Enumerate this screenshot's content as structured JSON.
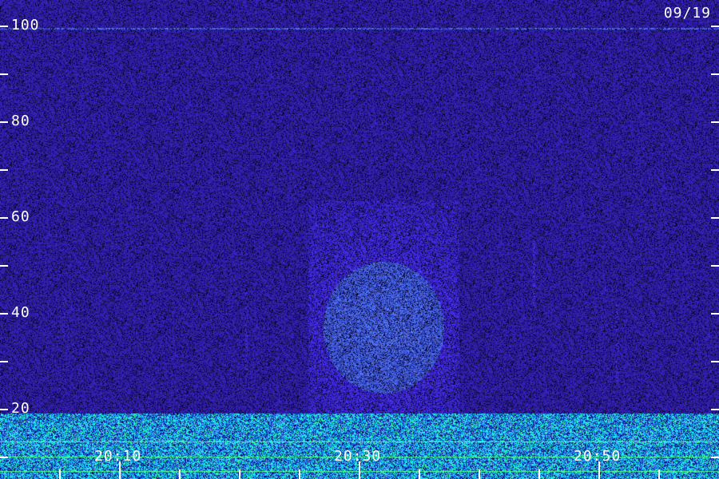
{
  "date_label": "09/19",
  "y_axis": {
    "labels": [
      "100",
      "80",
      "60",
      "40",
      "20"
    ],
    "label_values": [
      100,
      80,
      60,
      40,
      20
    ],
    "minor_tick_values": [
      90,
      70,
      50,
      30,
      10
    ],
    "range": [
      0,
      103
    ]
  },
  "x_axis": {
    "labels": [
      "20:10",
      "20:30",
      "20:50"
    ],
    "label_minutes": [
      10,
      30,
      50
    ],
    "range_minutes": [
      0,
      60
    ],
    "tick_step_minutes": 5
  },
  "colors": {
    "background": "#1a0f4a",
    "noise_low": "#2a1a8a",
    "noise_high": "#3c3cff",
    "band_cyan": "#30d0ff",
    "band_green": "#40ff80",
    "axis": "#ffffff"
  }
}
